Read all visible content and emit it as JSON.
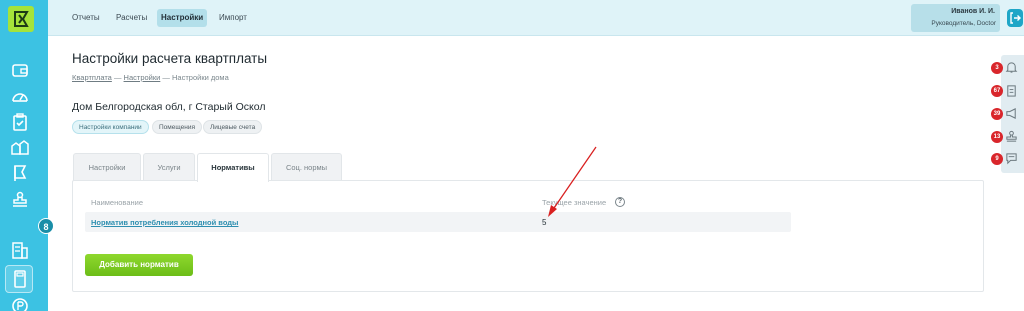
{
  "colors": {
    "sidebar": "#3cc2e3",
    "logo": "#a5e33a",
    "topbar": "#dff3f8",
    "accent_green": "#7acb22",
    "badge_red": "#d9262b",
    "annotation_arrow": "#d92020"
  },
  "sidebar": {
    "logo_letter": "K",
    "badge_count": "8",
    "icons": [
      "wallet-icon",
      "gauge-icon",
      "clipboard-check-icon",
      "houses-icon",
      "flag-icon",
      "stamp-icon",
      "building-icon",
      "calculator-icon",
      "coin-icon"
    ]
  },
  "topnav": {
    "items": [
      "Отчеты",
      "Расчеты",
      "Настройки",
      "Импорт"
    ],
    "active": "Настройки"
  },
  "user": {
    "name": "Иванов И. И.",
    "role": "Руководитель, Doctor"
  },
  "right_panel": {
    "badges": [
      "3",
      "67",
      "39",
      "13",
      "9"
    ],
    "icons": [
      "bell-icon",
      "clipboard-icon",
      "megaphone-icon",
      "stamp-icon",
      "chat-icon"
    ]
  },
  "page": {
    "title": "Настройки расчета квартплаты",
    "breadcrumb": [
      "Квартплата",
      "Настройки",
      "Настройки дома"
    ],
    "breadcrumb_sep": "—",
    "house": "Дом Белгородская обл, г Старый Оскол",
    "chips": [
      "Настройки компании",
      "Помещения",
      "Лицевые счета"
    ]
  },
  "tabs": [
    "Настройки",
    "Услуги",
    "Нормативы",
    "Соц. нормы"
  ],
  "active_tab": "Нормативы",
  "table": {
    "headers": [
      "Наименование",
      "Текущее значение"
    ],
    "help": "?",
    "rows": [
      {
        "name": "Норматив потребления холодной воды",
        "value": "5"
      }
    ]
  },
  "add_button": "Добавить норматив"
}
